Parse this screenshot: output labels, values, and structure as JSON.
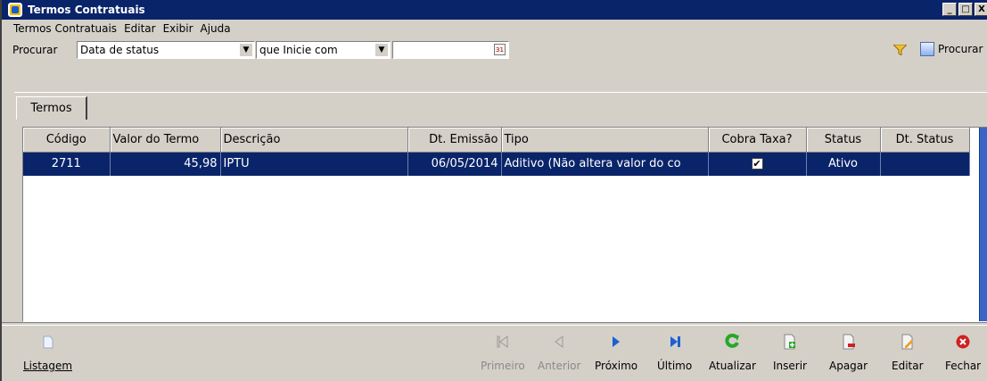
{
  "window": {
    "title": "Termos Contratuais",
    "buttons": [
      "_",
      "□",
      "X"
    ]
  },
  "menu": [
    "Termos Contratuais",
    "Editar",
    "Exibir",
    "Ajuda"
  ],
  "search": {
    "label": "Procurar",
    "field_value": "Data de status",
    "operator_value": "que Inicie com",
    "value": "",
    "calendar_icon": "calendar-icon",
    "filter_icon": "filter-icon",
    "search_button": "Procurar"
  },
  "tabs": [
    {
      "label": "Termos"
    }
  ],
  "grid": {
    "columns": [
      "Código",
      "Valor do Termo",
      "Descrição",
      "Dt. Emissão",
      "Tipo",
      "Cobra Taxa?",
      "Status",
      "Dt. Status"
    ],
    "rows": [
      {
        "codigo": "2711",
        "valor": "45,98",
        "descricao": "IPTU",
        "emissao": "06/05/2014",
        "tipo": "Aditivo (Não altera valor do co",
        "cobra_taxa": "✔",
        "status": "Ativo",
        "dt_status": ""
      }
    ]
  },
  "toolbar": {
    "listagem": "Listagem",
    "primeiro": "Primeiro",
    "anterior": "Anterior",
    "proximo": "Próximo",
    "ultimo": "Último",
    "atualizar": "Atualizar",
    "inserir": "Inserir",
    "apagar": "Apagar",
    "editar": "Editar",
    "fechar": "Fechar"
  },
  "colors": {
    "titlebar": "#0a246a",
    "selection": "#0a246a",
    "face": "#d4d0c8",
    "nav_blue": "#1c5fd6",
    "refresh_green": "#2aa62a",
    "close_red": "#d02020"
  }
}
